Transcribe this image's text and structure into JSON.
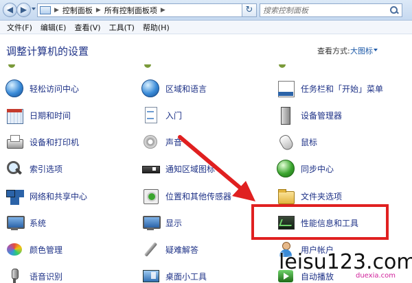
{
  "address_bar": {
    "crumbs": [
      "控制面板",
      "所有控制面板项"
    ],
    "search_placeholder": "搜索控制面板"
  },
  "menu": [
    "文件(F)",
    "编辑(E)",
    "查看(V)",
    "工具(T)",
    "帮助(H)"
  ],
  "header": {
    "title": "调整计算机的设置",
    "view_by_label": "查看方式:",
    "view_by_value": "大图标"
  },
  "items": [
    {
      "label": "轻松访问中心",
      "icon": "ease-of-access-icon"
    },
    {
      "label": "区域和语言",
      "icon": "region-language-icon"
    },
    {
      "label": "任务栏和「开始」菜单",
      "icon": "taskbar-start-menu-icon"
    },
    {
      "label": "日期和时间",
      "icon": "date-time-icon"
    },
    {
      "label": "入门",
      "icon": "getting-started-icon"
    },
    {
      "label": "设备管理器",
      "icon": "device-manager-icon"
    },
    {
      "label": "设备和打印机",
      "icon": "devices-printers-icon"
    },
    {
      "label": "声音",
      "icon": "sound-icon"
    },
    {
      "label": "鼠标",
      "icon": "mouse-icon"
    },
    {
      "label": "索引选项",
      "icon": "indexing-options-icon"
    },
    {
      "label": "通知区域图标",
      "icon": "notification-area-icon"
    },
    {
      "label": "同步中心",
      "icon": "sync-center-icon"
    },
    {
      "label": "网络和共享中心",
      "icon": "network-sharing-icon"
    },
    {
      "label": "位置和其他传感器",
      "icon": "location-sensors-icon"
    },
    {
      "label": "文件夹选项",
      "icon": "folder-options-icon"
    },
    {
      "label": "系统",
      "icon": "system-icon"
    },
    {
      "label": "显示",
      "icon": "display-icon"
    },
    {
      "label": "性能信息和工具",
      "icon": "performance-info-icon"
    },
    {
      "label": "颜色管理",
      "icon": "color-management-icon"
    },
    {
      "label": "疑难解答",
      "icon": "troubleshooting-icon"
    },
    {
      "label": "用户帐户",
      "icon": "user-accounts-icon"
    },
    {
      "label": "语音识别",
      "icon": "speech-recognition-icon"
    },
    {
      "label": "桌面小工具",
      "icon": "desktop-gadgets-icon"
    },
    {
      "label": "自动播放",
      "icon": "autoplay-icon"
    }
  ],
  "annotation": {
    "highlight_color": "#e02020",
    "watermark": "leisu123.com",
    "watermark_small": "duexia.com"
  }
}
